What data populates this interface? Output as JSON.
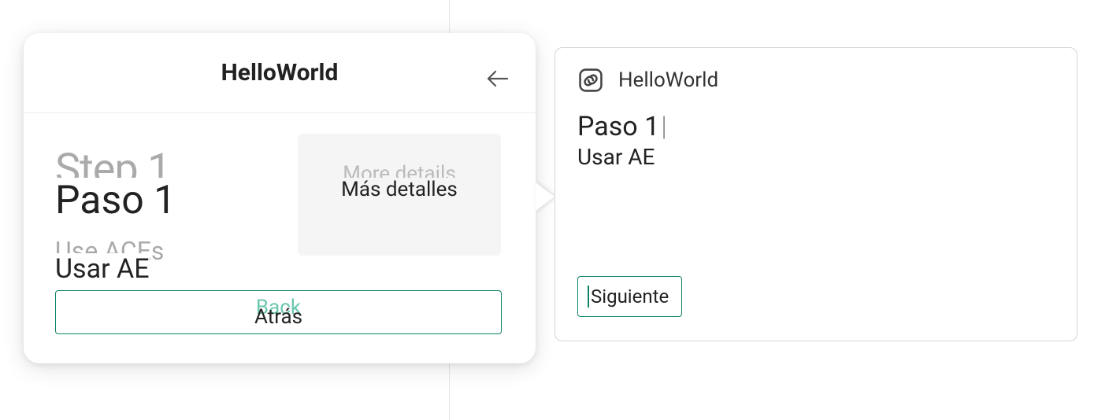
{
  "leftDialog": {
    "title": "HelloWorld",
    "stepGhost": "Step 1",
    "stepMain": "Paso 1",
    "useGhost": "Use ACEs",
    "useMain": "Usar AE",
    "detailGhost": "More details",
    "detailMain": "Más detalles",
    "backGhost": "Back",
    "backLabel": "Atrás"
  },
  "rightCard": {
    "title": "HelloWorld",
    "step": "Paso 1",
    "usar": "Usar AE",
    "usarFaded": "",
    "nextLabel": "Siguiente"
  }
}
